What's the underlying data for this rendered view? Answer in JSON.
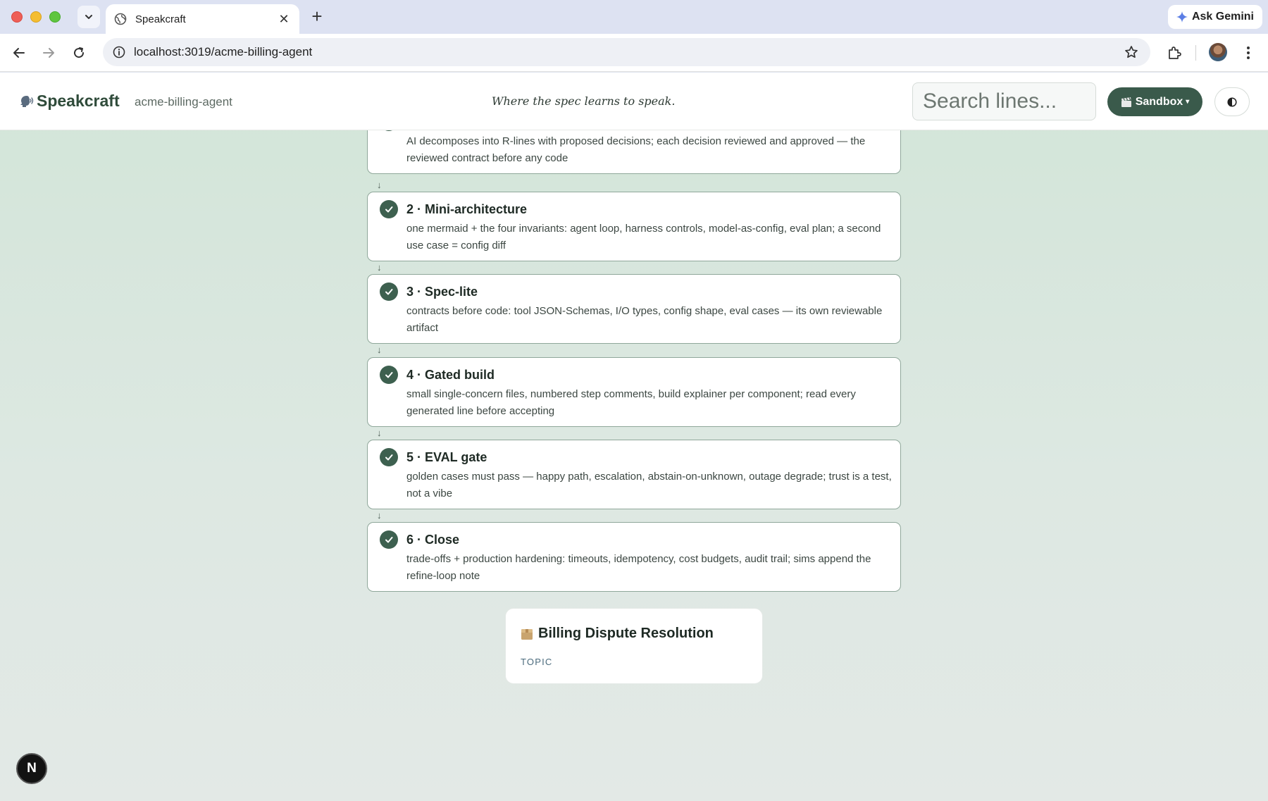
{
  "browser": {
    "tab_title": "Speakcraft",
    "url": "localhost:3019/acme-billing-agent",
    "ask_gemini": "Ask Gemini"
  },
  "header": {
    "brand": "Speakcraft",
    "project": "acme-billing-agent",
    "tagline": "Where the spec learns to speak.",
    "search_placeholder": "Search lines...",
    "sandbox_label": "Sandbox",
    "sandbox_caret": "▾",
    "sandbox_icon": "clapper-icon"
  },
  "steps": [
    {
      "title": "",
      "description": "AI decomposes into R-lines with proposed decisions; each decision reviewed and approved — the reviewed contract before any code",
      "status": "done"
    },
    {
      "title": "2 · Mini-architecture",
      "description": "one mermaid + the four invariants: agent loop, harness controls, model-as-config, eval plan; a second use case = config diff",
      "status": "done"
    },
    {
      "title": "3 · Spec-lite",
      "description": "contracts before code: tool JSON-Schemas, I/O types, config shape, eval cases — its own reviewable artifact",
      "status": "done"
    },
    {
      "title": "4 · Gated build",
      "description": "small single-concern files, numbered step comments, build explainer per component; read every generated line before accepting",
      "status": "done"
    },
    {
      "title": "5 · EVAL gate",
      "description": "golden cases must pass — happy path, escalation, abstain-on-unknown, outage degrade; trust is a test, not a vibe",
      "status": "done"
    },
    {
      "title": "6 · Close",
      "description": "trade-offs + production hardening: timeouts, idempotency, cost budgets, audit trail; sims append the refine-loop note",
      "status": "done"
    }
  ],
  "connector_glyph": "↓",
  "topic": {
    "title": "Billing Dispute Resolution",
    "label": "TOPIC"
  },
  "dev_badge": "N",
  "colors": {
    "accent": "#3a5a4b",
    "check": "#3d604f",
    "card_border": "#8fa79a"
  }
}
